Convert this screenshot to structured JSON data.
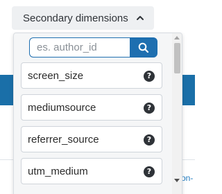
{
  "toggle": {
    "label": "Secondary dimensions",
    "icon": "chevron-up-icon"
  },
  "search": {
    "placeholder": "es. author_id",
    "icon": "search-icon"
  },
  "items": [
    {
      "label": "screen_size",
      "help_icon": "?"
    },
    {
      "label": "mediumsource",
      "help_icon": "?"
    },
    {
      "label": "referrer_source",
      "help_icon": "?"
    },
    {
      "label": "utm_medium",
      "help_icon": "?"
    }
  ],
  "background": {
    "edge_text": "on-"
  },
  "colors": {
    "accent": "#1e6fb0",
    "band": "#1a6fa8"
  }
}
